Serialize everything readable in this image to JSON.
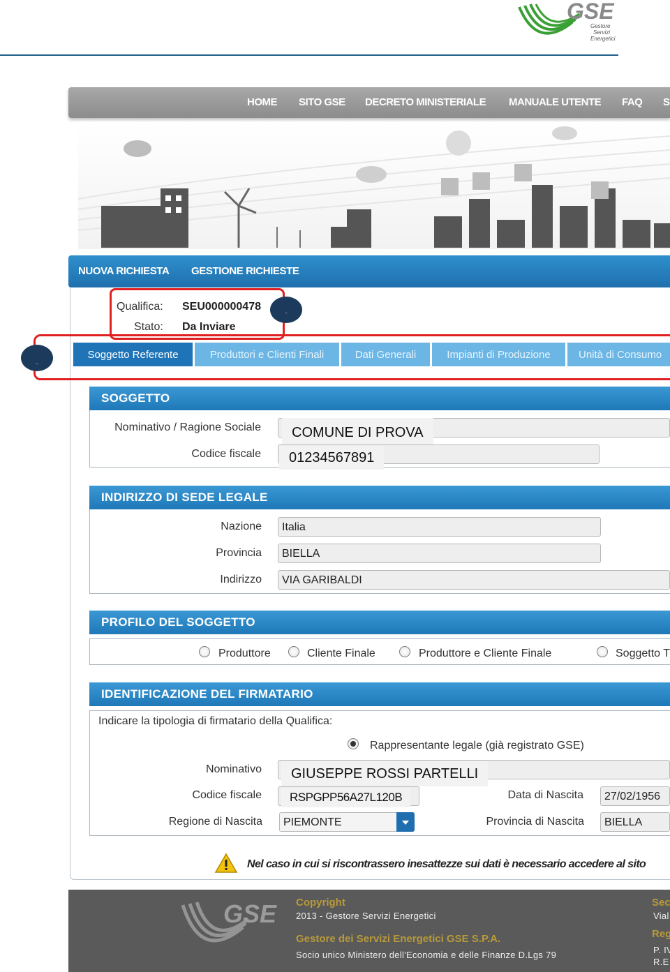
{
  "brand": {
    "logo_text": "GSE",
    "logo_sub": [
      "Gestore",
      "Servizi",
      "Energetici"
    ],
    "color_green": "#3aa035",
    "color_blue": "#1f78b8"
  },
  "topnav": {
    "items": [
      "HOME",
      "SITO GSE",
      "DECRETO MINISTERIALE",
      "MANUALE UTENTE",
      "FAQ",
      "S"
    ]
  },
  "mainnav": {
    "items": [
      "NUOVA RICHIESTA",
      "GESTIONE RICHIESTE"
    ]
  },
  "qualifica": {
    "label": "Qualifica:",
    "value": "SEU000000478",
    "stato_label": "Stato:",
    "stato_value": "Da Inviare"
  },
  "badges": [
    "1",
    "2"
  ],
  "tabs": [
    "Soggetto Referente",
    "Produttori e Clienti Finali",
    "Dati Generali",
    "Impianti di Produzione",
    "Unità di Consumo"
  ],
  "soggetto": {
    "header": "SOGGETTO",
    "nominativo_label": "Nominativo / Ragione Sociale",
    "nominativo_value": "COMUNE DI PROVA",
    "cf_label": "Codice fiscale",
    "cf_value": "01234567891"
  },
  "indirizzo": {
    "header": "INDIRIZZO DI SEDE LEGALE",
    "nazione_label": "Nazione",
    "nazione_value": "Italia",
    "provincia_label": "Provincia",
    "provincia_value": "BIELLA",
    "indirizzo_label": "Indirizzo",
    "indirizzo_value": "VIA GARIBALDI"
  },
  "profilo": {
    "header": "PROFILO DEL SOGGETTO",
    "options": [
      "Produttore",
      "Cliente Finale",
      "Produttore e Cliente Finale",
      "Soggetto T"
    ]
  },
  "firmatario": {
    "header": "IDENTIFICAZIONE DEL FIRMATARIO",
    "intro": "Indicare la tipologia di firmatario della Qualifica:",
    "radio_label": "Rappresentante legale (già registrato GSE)",
    "nominativo_label": "Nominativo",
    "nominativo_value": "GIUSEPPE ROSSI PARTELLI",
    "cf_label": "Codice fiscale",
    "cf_value": "RSPGPP56A27L120B",
    "nascita_label": "Data di Nascita",
    "nascita_value": "27/02/1956",
    "regione_label": "Regione di Nascita",
    "regione_value": "PIEMONTE",
    "provincia_label": "Provincia di Nascita",
    "provincia_value": "BIELLA"
  },
  "warning": "Nel caso in cui si riscontrassero inesattezze sui dati è necessario accedere al sito",
  "footer": {
    "copyright_h": "Copyright",
    "copyright_t": "2013 - Gestore Servizi Energetici",
    "gestore_h": "Gestore dei Servizi Energetici GSE S.P.A.",
    "gestore_t": "Socio unico Ministero dell'Economia e delle Finanze D.Lgs 79",
    "right_h1": "Sec",
    "right_t1": "Vial",
    "right_h2": "Reg",
    "right_t2": "P. IV",
    "right_t3": "R.E"
  }
}
